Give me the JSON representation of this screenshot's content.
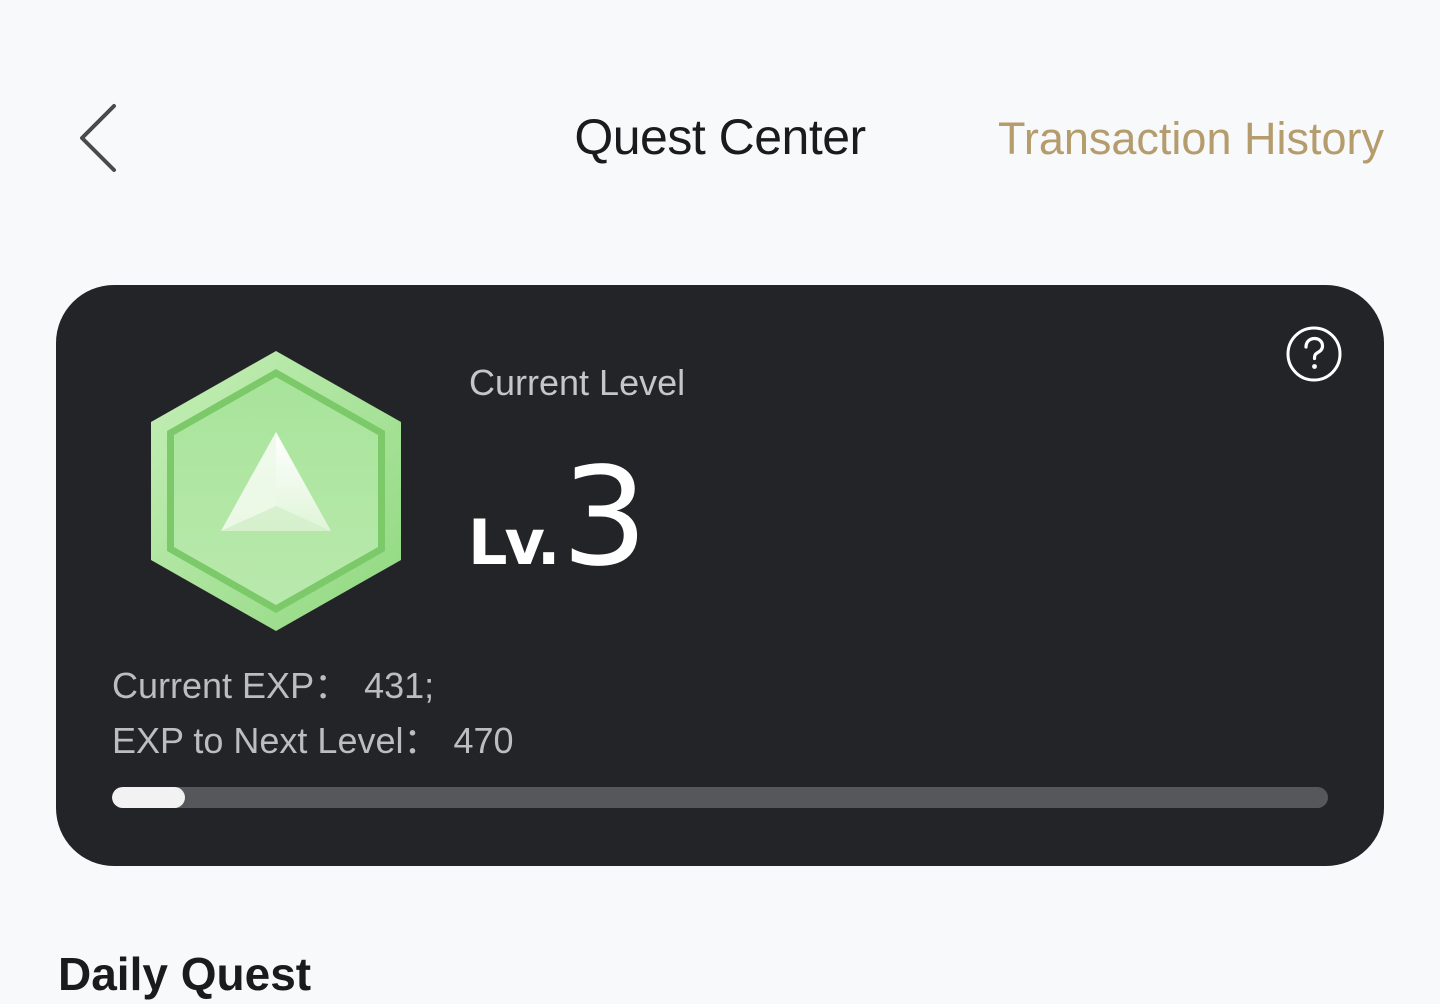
{
  "header": {
    "title": "Quest Center",
    "history_link": "Transaction History",
    "back_icon": "chevron-left-icon"
  },
  "level_card": {
    "label": "Current Level",
    "level_prefix": "Lv.",
    "level_number": "3",
    "badge_icon": "hexagon-level-badge-icon",
    "help_icon": "question-circle-icon",
    "current_exp_label": "Current EXP：",
    "current_exp_value": "431;",
    "next_exp_label": "EXP to Next Level：",
    "next_exp_value": "470",
    "progress_fraction": 0.06
  },
  "sections": {
    "daily_title": "Daily Quest"
  },
  "colors": {
    "page_background": "#f8f9fb",
    "card_background": "#232427",
    "accent_gold": "#b59c6d",
    "badge_green": "#7fcc6a"
  }
}
